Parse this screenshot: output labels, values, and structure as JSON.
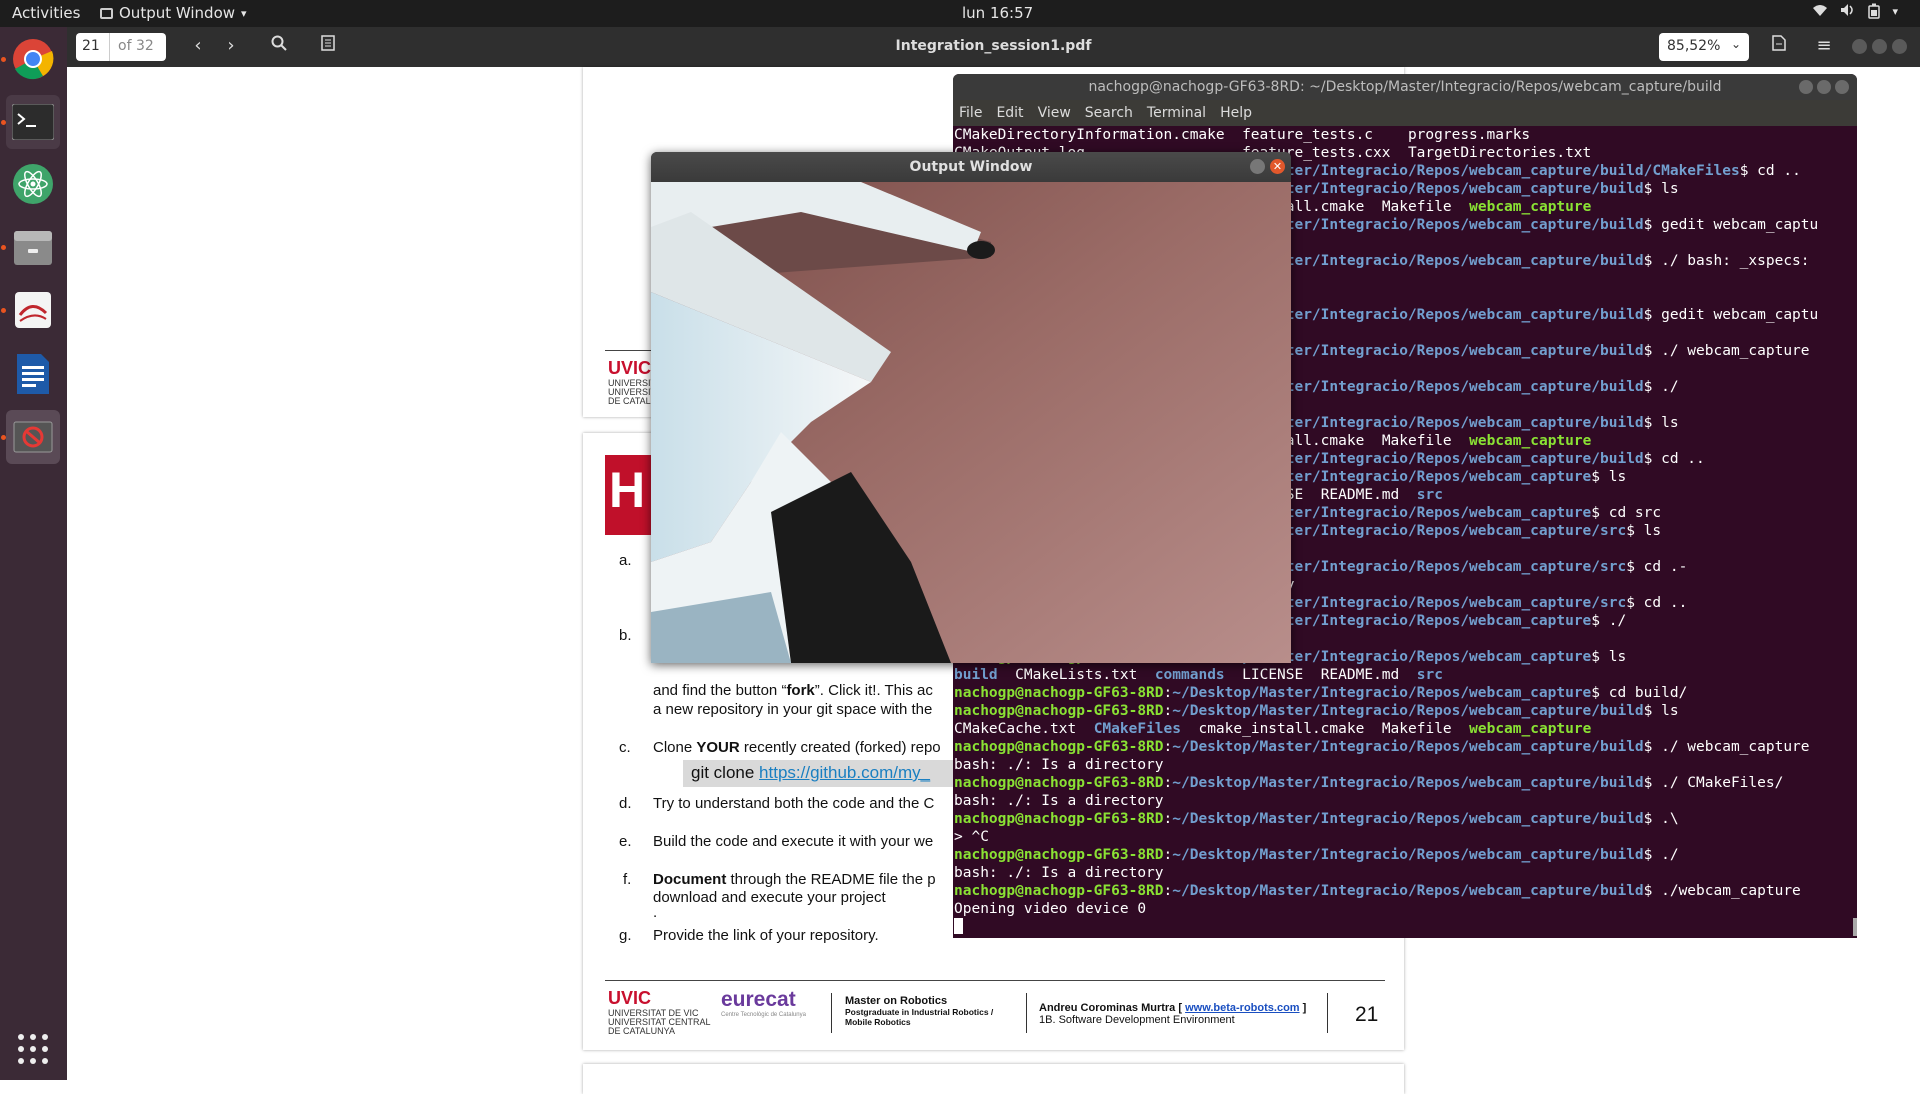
{
  "topbar": {
    "activities": "Activities",
    "app_menu": "Output Window",
    "clock": "lun 16:57"
  },
  "viewer": {
    "page_current": "21",
    "page_total": "of 32",
    "filename": "Integration_session1.pdf",
    "zoom": "85,52%"
  },
  "pdf": {
    "uvic_logo": "UVIC",
    "uvic_lines": [
      "UNIVERSITAT DE VIC",
      "UNIVERSITAT CENTRAL",
      "DE CATALUNYA"
    ],
    "heading_letter": "H",
    "items": [
      {
        "letter": "a.",
        "text": ""
      },
      {
        "letter": "b.",
        "text": ""
      },
      {
        "letter": "c.",
        "bold": "YOUR",
        "pre": "Clone ",
        "post": " recently created (forked) repo"
      },
      {
        "letter": "d.",
        "text": "Try to understand both the code and the C"
      },
      {
        "letter": "e.",
        "text": "Build the code and execute it with your we"
      },
      {
        "letter": "f.",
        "bold": "Document",
        "pre": "",
        "post": "  through the README file the p"
      },
      {
        "letter": "g.",
        "text": "Provide the link of your repository."
      }
    ],
    "fork_line1_pre": "and find the button “",
    "fork_bold": "fork",
    "fork_line1_post": "”. Click it!. This ac",
    "fork_line2": "a new repository in your git space with the",
    "git_clone": "git clone ",
    "git_link": "https://github.com/my_",
    "item_f_line2": "download and execute your project",
    "item_f_line3": ".",
    "footer": {
      "uvic": "UVIC",
      "uvic_lines": [
        "UNIVERSITAT DE VIC",
        "UNIVERSITAT CENTRAL",
        "DE CATALUNYA"
      ],
      "eurecat": "eurecat",
      "eurecat_sub": "Centre Tecnològic de Catalunya",
      "master": "Master on Robotics",
      "master_sub1": "Postgraduate in Industrial Robotics /",
      "master_sub2": "Mobile Robotics",
      "author_pre": "Andreu Corominas Murtra [ ",
      "author_link": "www.beta-robots.com",
      "author_post": " ]",
      "course": "1B. Software Development Environment",
      "page_number": "21"
    }
  },
  "terminal": {
    "title": "nachogp@nachogp-GF63-8RD: ~/Desktop/Master/Integracio/Repos/webcam_capture/build",
    "menu": [
      "File",
      "Edit",
      "View",
      "Search",
      "Terminal",
      "Help"
    ],
    "lines": [
      {
        "type": "plain",
        "text": "CMakeDirectoryInformation.cmake  feature_tests.c    progress.marks"
      },
      {
        "type": "plain",
        "text": "CMakeOutput.log                  feature_tests.cxx  TargetDirectories.txt"
      },
      {
        "type": "prompt",
        "path": "~/Desktop/Master/Integracio/Repos/webcam_capture/build/CMakeFiles",
        "cmd": "$ cd .."
      },
      {
        "type": "prompt",
        "path": "~/Desktop/Master/Integracio/Repos/webcam_capture/build",
        "cmd": "$ ls"
      },
      {
        "type": "ls1",
        "text": ""
      },
      {
        "type": "prompt",
        "path": "~/Desktop/Master/Integracio/Repos/webcam_capture/build",
        "cmd": "$ gedit webcam_captu"
      },
      {
        "type": "plain",
        "text": ""
      },
      {
        "type": "prompt",
        "path": "~/Desktop/Master/Integracio/Repos/webcam_capture/build",
        "cmd": "$ ./ bash: _xspecs:"
      },
      {
        "type": "plain",
        "text": ""
      },
      {
        "type": "plain",
        "text": ""
      },
      {
        "type": "prompt",
        "path": "~/Desktop/Master/Integracio/Repos/webcam_capture/build",
        "cmd": "$ gedit webcam_captu"
      },
      {
        "type": "plain",
        "text": ""
      },
      {
        "type": "prompt",
        "path": "~/Desktop/Master/Integracio/Repos/webcam_capture/build",
        "cmd": "$ ./ webcam_capture"
      },
      {
        "type": "plain",
        "text": ""
      },
      {
        "type": "prompt",
        "path": "~/Desktop/Master/Integracio/Repos/webcam_capture/build",
        "cmd": "$ ./"
      },
      {
        "type": "plain",
        "text": ""
      },
      {
        "type": "prompt",
        "path": "~/Desktop/Master/Integracio/Repos/webcam_capture/build",
        "cmd": "$ ls"
      },
      {
        "type": "ls1",
        "text": ""
      },
      {
        "type": "prompt",
        "path": "~/Desktop/Master/Integracio/Repos/webcam_capture/build",
        "cmd": "$ cd .."
      },
      {
        "type": "prompt",
        "path": "~/Desktop/Master/Integracio/Repos/webcam_capture",
        "cmd": "$ ls"
      },
      {
        "type": "ls2",
        "text": ""
      },
      {
        "type": "prompt",
        "path": "~/Desktop/Master/Integracio/Repos/webcam_capture",
        "cmd": "$ cd src"
      },
      {
        "type": "prompt",
        "path": "~/Desktop/Master/Integracio/Repos/webcam_capture/src",
        "cmd": "$ ls"
      },
      {
        "type": "plain",
        "text": ""
      },
      {
        "type": "prompt",
        "path": "~/Desktop/Master/Integracio/Repos/webcam_capture/src",
        "cmd": "$ cd .-"
      },
      {
        "type": "plain",
        "text": "bash: cd: .-: No such file or directory"
      },
      {
        "type": "prompt",
        "path": "~/Desktop/Master/Integracio/Repos/webcam_capture/src",
        "cmd": "$ cd .."
      },
      {
        "type": "prompt",
        "path": "~/Desktop/Master/Integracio/Repos/webcam_capture",
        "cmd": "$ ./"
      },
      {
        "type": "plain",
        "text": ""
      },
      {
        "type": "prompt",
        "path": "~/Desktop/Master/Integracio/Repos/webcam_capture",
        "cmd": "$ ls"
      },
      {
        "type": "ls2",
        "text": ""
      },
      {
        "type": "prompt",
        "path": "~/Desktop/Master/Integracio/Repos/webcam_capture",
        "cmd": "$ cd build/"
      },
      {
        "type": "prompt",
        "path": "~/Desktop/Master/Integracio/Repos/webcam_capture/build",
        "cmd": "$ ls"
      },
      {
        "type": "ls1",
        "text": ""
      },
      {
        "type": "prompt",
        "path": "~/Desktop/Master/Integracio/Repos/webcam_capture/build",
        "cmd": "$ ./ webcam_capture"
      },
      {
        "type": "plain",
        "text": "bash: ./: Is a directory"
      },
      {
        "type": "prompt",
        "path": "~/Desktop/Master/Integracio/Repos/webcam_capture/build",
        "cmd": "$ ./ CMakeFiles/"
      },
      {
        "type": "plain",
        "text": "bash: ./: Is a directory"
      },
      {
        "type": "prompt",
        "path": "~/Desktop/Master/Integracio/Repos/webcam_capture/build",
        "cmd": "$ .\\"
      },
      {
        "type": "plain",
        "text": "> ^C"
      },
      {
        "type": "prompt",
        "path": "~/Desktop/Master/Integracio/Repos/webcam_capture/build",
        "cmd": "$ ./"
      },
      {
        "type": "plain",
        "text": "bash: ./: Is a directory"
      },
      {
        "type": "prompt",
        "path": "~/Desktop/Master/Integracio/Repos/webcam_capture/build",
        "cmd": "$ ./webcam_capture"
      },
      {
        "type": "plain",
        "text": "Opening video device 0"
      }
    ],
    "host": "nachogp@nachogp-GF63-8RD",
    "ls_build": [
      "CMakeCache.txt",
      "CMakeFiles",
      "cmake_install.cmake",
      "Makefile",
      "webcam_capture"
    ],
    "ls_repo": [
      "build",
      "CMakeLists.txt",
      "commands",
      "LICENSE",
      "README.md",
      "src"
    ]
  },
  "output_window": {
    "title": "Output Window"
  },
  "dock": {
    "items": [
      "chrome-icon",
      "terminal-icon",
      "atom-icon",
      "files-icon",
      "document-viewer-icon",
      "writer-icon",
      "webcam-app-icon"
    ]
  }
}
